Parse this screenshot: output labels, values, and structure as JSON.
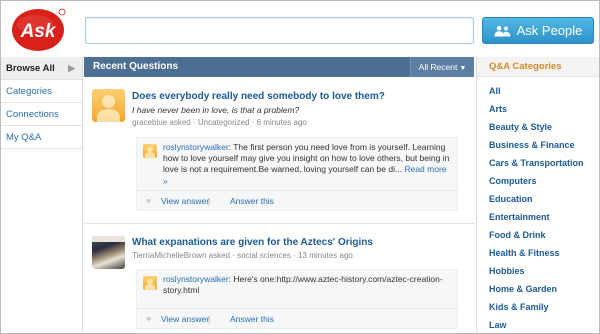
{
  "brand": {
    "logo_text": "Ask",
    "accent": "#d9211c"
  },
  "search": {
    "value": "",
    "placeholder": "",
    "button_label": "Ask People",
    "button_icon": "people-icon"
  },
  "leftnav": {
    "items": [
      {
        "label": "Browse All",
        "active": true
      },
      {
        "label": "Categories",
        "active": false
      },
      {
        "label": "Connections",
        "active": false
      },
      {
        "label": "My Q&A",
        "active": false
      }
    ]
  },
  "main": {
    "header_title": "Recent Questions",
    "filter_label": "All Recent",
    "questions": [
      {
        "title": "Does everybody really need somebody to love them?",
        "detail": "I have never been in love, is that a problem?",
        "asker": "graceblue",
        "asked_word": "asked",
        "separator": "·",
        "category": "Uncategorized",
        "time": "6 minutes ago",
        "answer": {
          "user": "roslynstorywalker",
          "text": "The first person you need love from is yourself. Learning how to love yourself may give you insight on how to love others, but being in love is not a requirement.Be warned, loving yourself can be di...",
          "more": "Read more »",
          "view": "View answer",
          "divider": "|",
          "answer_this": "Answer this"
        }
      },
      {
        "title": "What expanations are given for the Aztecs' Origins",
        "detail": "",
        "asker": "TierriaMichelleBrown",
        "asked_word": "asked",
        "separator": "·",
        "category": "social sciences",
        "time": "13 minutes ago",
        "answer": {
          "user": "roslynstorywalker",
          "text": "Here's one:http://www.aztec-history.com/aztec-creation-story.html",
          "more": "",
          "view": "View answer",
          "divider": "|",
          "answer_this": "Answer this"
        }
      }
    ]
  },
  "categories": {
    "title": "Q&A Categories",
    "items": [
      "All",
      "Arts",
      "Beauty & Style",
      "Business & Finance",
      "Cars & Transportation",
      "Computers",
      "Education",
      "Entertainment",
      "Food & Drink",
      "Health & Fitness",
      "Hobbies",
      "Home & Garden",
      "Kids & Family",
      "Law"
    ]
  }
}
